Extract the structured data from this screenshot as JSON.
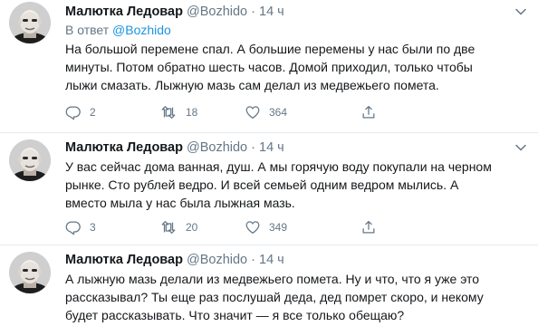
{
  "tweets": [
    {
      "name": "Малютка Ледовар",
      "handle": "@Bozhido",
      "dot": "·",
      "time": "14 ч",
      "reply_prefix": "В ответ",
      "reply_handle": "@Bozhido",
      "lines": [
        "На большой перемене спал. А большие перемены у нас были по две",
        "минуты. Потом обратно шесть часов. Домой приходил, только чтобы",
        "лыжи смазать. Лыжную мазь сам делал из медвежьего помета."
      ],
      "replies": "2",
      "retweets": "18",
      "likes": "364"
    },
    {
      "name": "Малютка Ледовар",
      "handle": "@Bozhido",
      "dot": "·",
      "time": "14 ч",
      "lines": [
        "У вас сейчас дома ванная, душ. А мы горячую воду покупали на черном",
        "рынке. Сто рублей ведро. И всей семьей одним ведром мылись. А",
        "вместо мыла у нас была лыжная мазь."
      ],
      "replies": "3",
      "retweets": "20",
      "likes": "349"
    },
    {
      "name": "Малютка Ледовар",
      "handle": "@Bozhido",
      "dot": "·",
      "time": "14 ч",
      "lines": [
        "А лыжную мазь делали из медвежьего помета. Ну и что, что я уже это",
        "рассказывал? Ты еще раз послушай деда, дед помрет скоро, и некому",
        "будет рассказывать. Что значит — я все только обещаю?"
      ]
    }
  ],
  "colors": {
    "text": "#14171a",
    "secondary": "#657786",
    "link": "#1b95e0",
    "divider": "#e6ecf0"
  },
  "icons": [
    "avatar-photo",
    "chevron-down-icon",
    "reply-icon",
    "retweet-icon",
    "like-icon",
    "share-icon"
  ]
}
